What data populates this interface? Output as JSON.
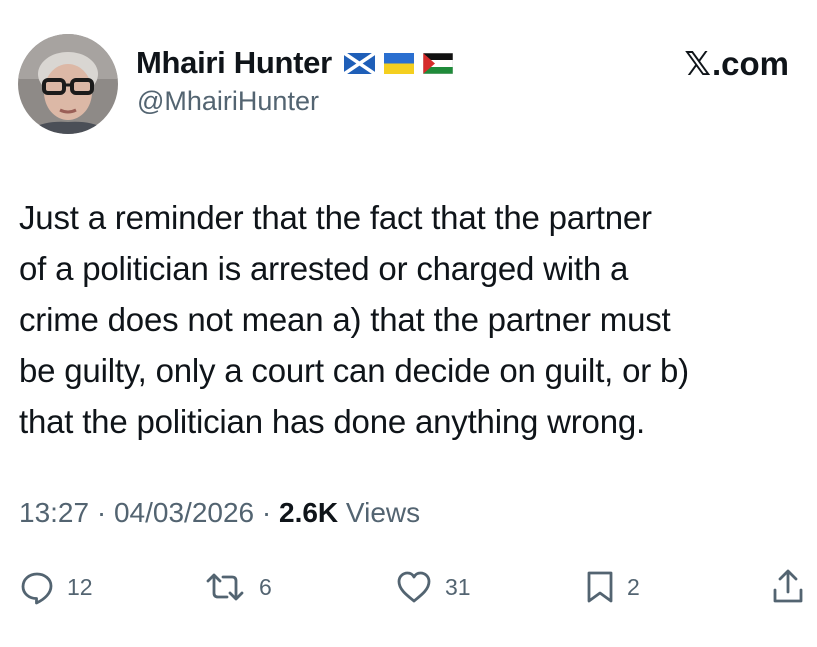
{
  "author": {
    "display_name": "Mhairi Hunter",
    "handle": "@MhairiHunter",
    "flags": [
      "scotland-flag-icon",
      "ukraine-flag-icon",
      "palestine-flag-icon"
    ]
  },
  "brand": {
    "x_glyph": "𝕏",
    "suffix": ".com"
  },
  "tweet": {
    "text": "Just a reminder that the fact that the partner\nof a politician is arrested or charged with a\ncrime does not mean a) that the partner must\nbe guilty, only a court can decide on guilt, or b)\nthat the politician has done anything wrong."
  },
  "meta": {
    "time": "13:27",
    "separator": " · ",
    "date": "04/03/2026",
    "views_count": "2.6K",
    "views_label": " Views"
  },
  "actions": {
    "replies": "12",
    "reposts": "6",
    "likes": "31",
    "bookmarks": "2"
  },
  "colors": {
    "text": "#0f1419",
    "secondary": "#536471",
    "icon": "#536471",
    "background": "#ffffff"
  }
}
